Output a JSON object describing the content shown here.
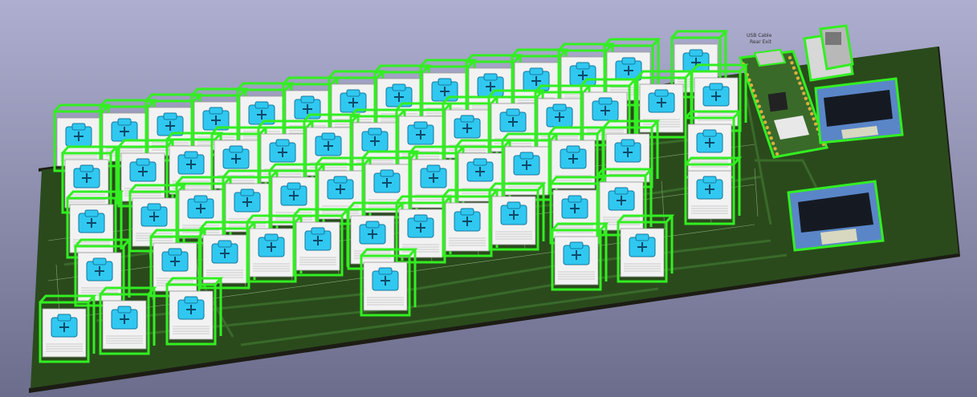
{
  "viewer": {
    "background_top": "#aeaed0",
    "background_bottom": "#6c6c8c"
  },
  "board": {
    "pcb_color": "#2a4a1c",
    "edge_color": "#1c1c14",
    "trace_color": "#3a6a2a",
    "outline_color": "#86a874",
    "silkscreen_lines": [
      "USB Cable",
      "Rear Exit"
    ]
  },
  "components": {
    "highlight_color": "#33ee22",
    "keycap_color": "#30c8f0",
    "switch_body_color": "#f2f2f2",
    "mcu_board_color": "#3a6a2a",
    "oled_screen_color": "#151a22",
    "oled_frame_color": "#5a86c8",
    "usb_connector_color": "#b8b8b8",
    "key_switch_count": 59,
    "oled_display_count": 2
  }
}
